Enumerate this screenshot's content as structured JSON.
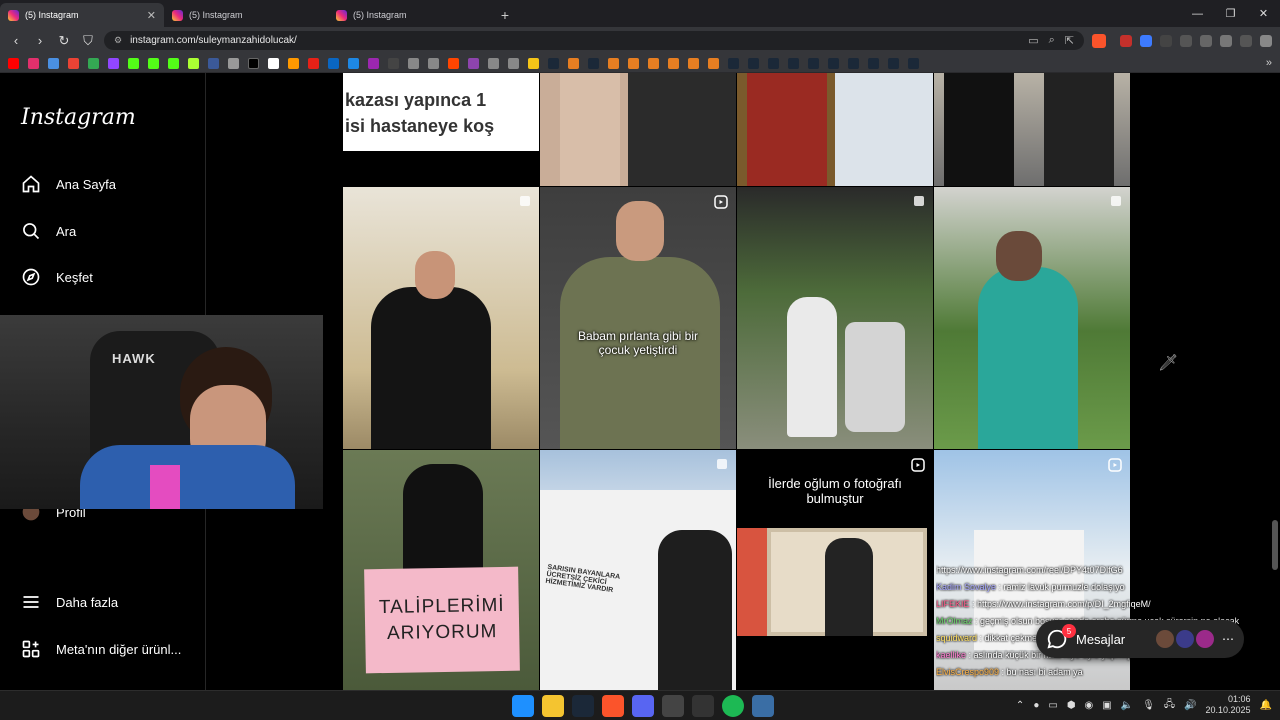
{
  "browser": {
    "tabs": [
      {
        "title": "(5) Instagram",
        "active": true
      },
      {
        "title": "(5) Instagram",
        "active": false
      },
      {
        "title": "(5) Instagram",
        "active": false
      }
    ],
    "url": "instagram.com/suleymanzahidolucak/",
    "new_tab": "+"
  },
  "sidebar": {
    "logo": "Instagram",
    "items": [
      {
        "label": "Ana Sayfa",
        "icon": "home-icon"
      },
      {
        "label": "Ara",
        "icon": "search-icon"
      },
      {
        "label": "Keşfet",
        "icon": "compass-icon"
      },
      {
        "label": "Profil",
        "icon": "profile-icon"
      },
      {
        "label": "Daha fazla",
        "icon": "menu-icon"
      },
      {
        "label": "Meta'nın diğer ürünl...",
        "icon": "meta-apps-icon"
      }
    ]
  },
  "posts": [
    {
      "caption": "kazası yapınca 1\nisi hastaneye koş",
      "type": "text"
    },
    {
      "caption": "",
      "type": "photo"
    },
    {
      "caption": "",
      "type": "photo"
    },
    {
      "caption": "",
      "type": "photo"
    },
    {
      "caption": "",
      "type": "carousel"
    },
    {
      "caption": "Babam pırlanta gibi bir çocuk yetiştirdi",
      "type": "reel"
    },
    {
      "caption": "",
      "type": "carousel"
    },
    {
      "caption": "",
      "type": "carousel"
    },
    {
      "caption": "TALİPLERİMİ ARIYORUM",
      "type": "photo"
    },
    {
      "caption": "SARISIN BAYANLARA ÜCRETSİZ ÇEKİCİ HİZMETİMİZ VARDIR",
      "type": "carousel"
    },
    {
      "caption": "İlerde oğlum o fotoğrafı bulmuştur",
      "type": "reel"
    },
    {
      "caption": "",
      "type": "reel"
    }
  ],
  "chat": [
    {
      "user": "",
      "text": "https://www.instagram.com/reel/DPY4t07DlfG6",
      "color": "#7ec8ff"
    },
    {
      "user": "Kadim Sovalye",
      "text": ": ramiz lavuk purmuzle dolaşıyo",
      "color": "#a9a9ff"
    },
    {
      "user": "LIFEKIE",
      "text": ": https://www.instagram.com/p/DI_2mgfiqeM/",
      "color": "#ff5c8a"
    },
    {
      "user": "MrOlmaz",
      "text": ": geçmiş olsun boşver sende araba sürme uçak sürersin ne olacak",
      "color": "#6bd36b"
    },
    {
      "user": "squidward",
      "text": ": dikkat çekmeseymiş",
      "color": "#ffe066"
    },
    {
      "user": "kaellike",
      "text": ": aslında küçük bir hata niye öyle yapmışlar ki",
      "color": "#ff7bd0"
    },
    {
      "user": "ElvisCrespo909",
      "text": ": bu nası bi adam ya",
      "color": "#ffb347"
    }
  ],
  "messages": {
    "label": "Mesajlar",
    "badge": "5"
  },
  "clock": {
    "time": "01:06",
    "date": "20.10.2025"
  },
  "overlay": {
    "chair_brand": "HAWK"
  }
}
